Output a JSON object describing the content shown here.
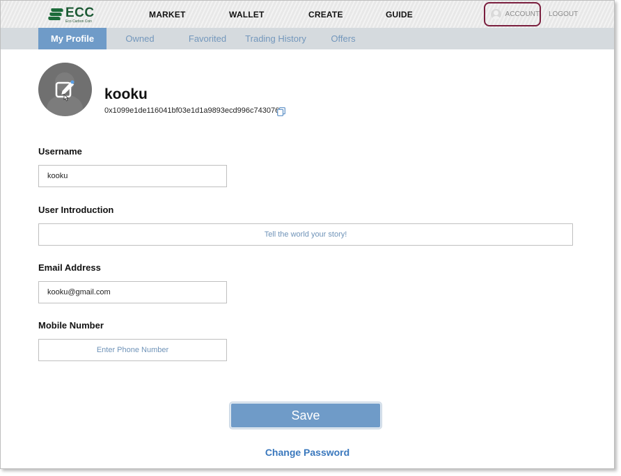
{
  "header": {
    "logo_title": "ECC",
    "logo_subtitle": "Eco Carbon Coin",
    "nav": [
      {
        "label": "MARKET"
      },
      {
        "label": "WALLET"
      },
      {
        "label": "CREATE"
      },
      {
        "label": "GUIDE"
      }
    ],
    "account_label": "ACCOUNT",
    "logout_label": "LOGOUT"
  },
  "tabs": [
    {
      "label": "My Profile",
      "active": true
    },
    {
      "label": "Owned",
      "active": false
    },
    {
      "label": "Favorited",
      "active": false
    },
    {
      "label": "Trading History",
      "active": false
    },
    {
      "label": "Offers",
      "active": false
    }
  ],
  "profile": {
    "display_name": "kooku",
    "wallet_address": "0x1099e1de116041bf03e1d1a9893ecd996c743076",
    "avatar_icon": "edit-icon"
  },
  "form": {
    "username": {
      "label": "Username",
      "value": "kooku"
    },
    "introduction": {
      "label": "User Introduction",
      "placeholder": "Tell the world your story!"
    },
    "email": {
      "label": "Email Address",
      "value": "kooku@gmail.com"
    },
    "mobile": {
      "label": "Mobile Number",
      "placeholder": "Enter Phone Number"
    }
  },
  "actions": {
    "save_label": "Save",
    "change_password_label": "Change Password"
  },
  "colors": {
    "accent": "#6f9bc8",
    "link": "#3a78bd",
    "account_border": "#7a1e3e",
    "logo_green": "#1c5a34"
  }
}
